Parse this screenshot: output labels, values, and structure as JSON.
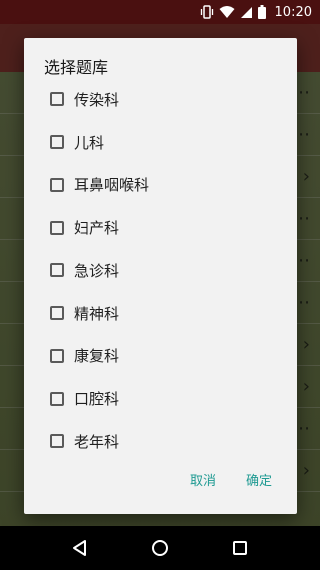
{
  "status_bar": {
    "time": "10:20",
    "icons": [
      "vibrate-icon",
      "wifi-icon",
      "cellular-icon",
      "battery-icon"
    ]
  },
  "dialog": {
    "title": "选择题库",
    "options": [
      {
        "label": "传染科",
        "checked": false
      },
      {
        "label": "儿科",
        "checked": false
      },
      {
        "label": "耳鼻咽喉科",
        "checked": false
      },
      {
        "label": "妇产科",
        "checked": false
      },
      {
        "label": "急诊科",
        "checked": false
      },
      {
        "label": "精神科",
        "checked": false
      },
      {
        "label": "康复科",
        "checked": false
      },
      {
        "label": "口腔科",
        "checked": false
      },
      {
        "label": "老年科",
        "checked": false
      }
    ],
    "cancel_label": "取消",
    "ok_label": "确定",
    "accent_color": "#1f9a92"
  },
  "nav_bar": {
    "icons": [
      "back-icon",
      "home-icon",
      "recents-icon"
    ]
  }
}
